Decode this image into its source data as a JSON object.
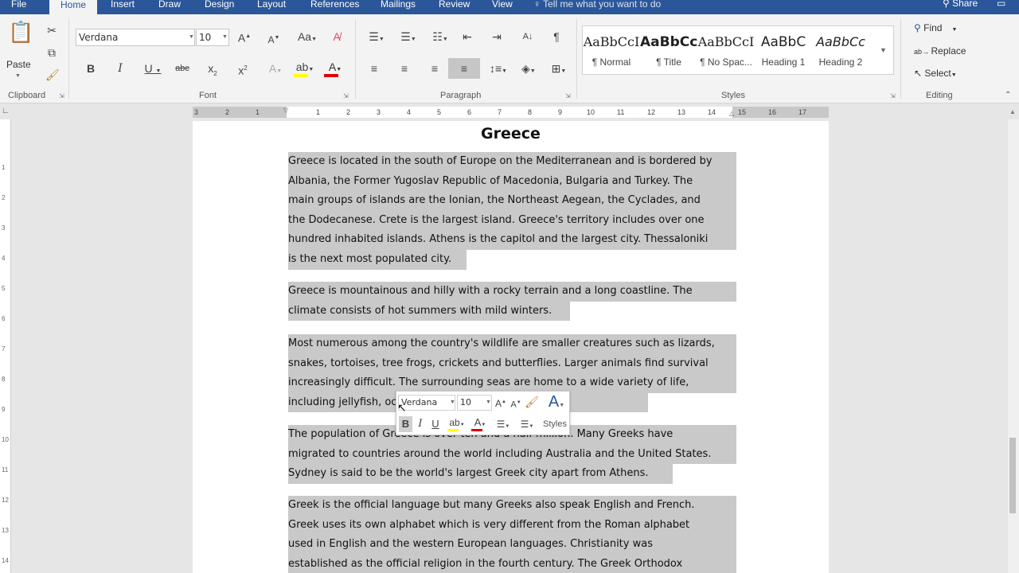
{
  "tabs": [
    "File",
    "Home",
    "Insert",
    "Draw",
    "Design",
    "Layout",
    "References",
    "Mailings",
    "Review",
    "View"
  ],
  "tell_me": "Tell me what you want to do",
  "share": "Share",
  "clipboard": {
    "paste": "Paste",
    "label": "Clipboard"
  },
  "font": {
    "name": "Verdana",
    "size": "10",
    "label": "Font"
  },
  "paragraph": {
    "label": "Paragraph"
  },
  "styles": {
    "label": "Styles",
    "items": [
      {
        "preview": "AaBbCcI",
        "name": "¶ Normal"
      },
      {
        "preview": "AaBbCc",
        "name": "¶ Title"
      },
      {
        "preview": "AaBbCcI",
        "name": "¶ No Spac..."
      },
      {
        "preview": "AaBbC",
        "name": "Heading 1"
      },
      {
        "preview": "AaBbCc",
        "name": "Heading 2"
      }
    ]
  },
  "editing": {
    "find": "Find",
    "replace": "Replace",
    "select": "Select",
    "label": "Editing"
  },
  "ruler_h": [
    "3",
    "2",
    "1",
    "1",
    "2",
    "3",
    "4",
    "5",
    "6",
    "7",
    "8",
    "9",
    "10",
    "11",
    "12",
    "13",
    "14",
    "15",
    "16",
    "17"
  ],
  "ruler_v": [
    "1",
    "2",
    "3",
    "4",
    "5",
    "6",
    "7",
    "8",
    "9",
    "10",
    "11",
    "12",
    "13",
    "14"
  ],
  "document": {
    "title": "Greece",
    "paragraphs": [
      [
        "Greece is located in the south of Europe on the Mediterranean and is bordered by",
        "Albania, the Former Yugoslav Republic of Macedonia, Bulgaria and Turkey. The",
        "main groups of islands are the Ionian, the Northeast Aegean, the Cyclades, and",
        "the Dodecanese. Crete is the largest island. Greece's territory includes over one",
        "hundred inhabited islands. Athens is the capitol and the largest city. Thessaloniki",
        "is the next most populated city."
      ],
      [
        "Greece is mountainous and hilly with a rocky terrain and a long coastline. The",
        "climate consists of hot summers with mild winters."
      ],
      [
        "Most numerous among the country's wildlife are smaller creatures such as lizards,",
        "snakes, tortoises, tree frogs, crickets and butterflies. Larger animals find survival",
        "increasingly difficult. The surrounding seas are home to a wide variety of life,",
        "including jellyfish, octopus, dolphins and sea turtles."
      ],
      [
        "The population of Greece is over ten and a half million. Many Greeks have",
        "migrated to countries around the world including Australia and the United States.",
        "Sydney is said to be the world's largest Greek city apart from Athens."
      ],
      [
        "Greek is the official language but many Greeks also speak English and French.",
        "Greek uses its own alphabet which is very different from the Roman alphabet",
        "used in English and the western European languages. Christianity was",
        "established as the official religion in the fourth century. The Greek Orthodox"
      ]
    ]
  },
  "mini_toolbar": {
    "font": "Verdana",
    "size": "10",
    "styles": "Styles"
  },
  "colors": {
    "accent": "#2b579a",
    "selection": "#c9c9c9",
    "highlight": "#ffff00",
    "font_color": "#e00000"
  }
}
